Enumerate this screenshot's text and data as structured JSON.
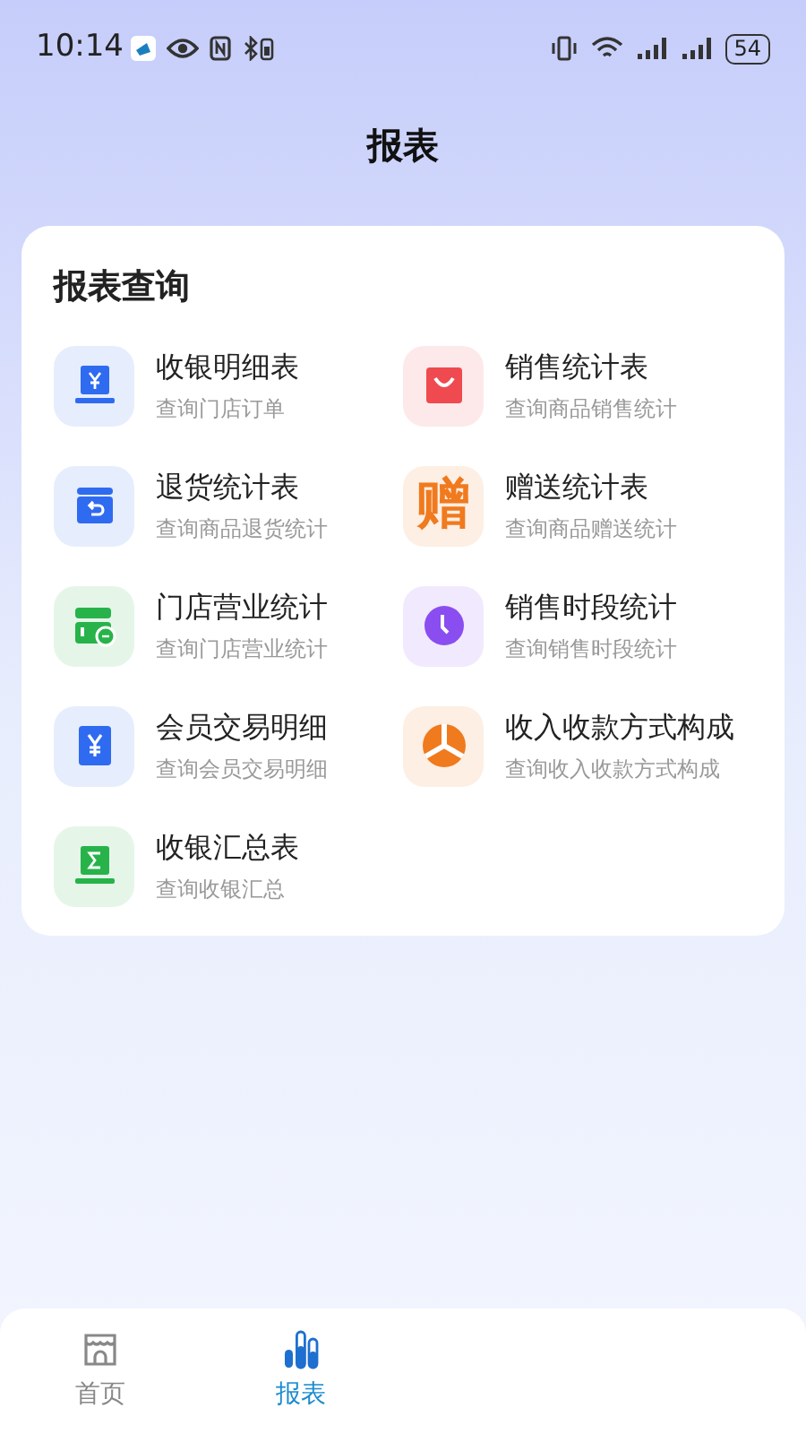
{
  "status_bar": {
    "time": "10:14",
    "battery": "54"
  },
  "header": {
    "title": "报表"
  },
  "card": {
    "title": "报表查询",
    "items": [
      {
        "title": "收银明细表",
        "subtitle": "查询门店订单",
        "kind": "receipt",
        "color": "#2f6bf0"
      },
      {
        "title": "销售统计表",
        "subtitle": "查询商品销售统计",
        "kind": "bag",
        "color": "#ef4a4f"
      },
      {
        "title": "退货统计表",
        "subtitle": "查询商品退货统计",
        "kind": "return",
        "color": "#2f6bf0"
      },
      {
        "title": "赠送统计表",
        "subtitle": "查询商品赠送统计",
        "kind": "glyph",
        "glyph": "赠",
        "color": "#f07a1e"
      },
      {
        "title": "门店营业统计",
        "subtitle": "查询门店营业统计",
        "kind": "store",
        "color": "#27b34a"
      },
      {
        "title": "销售时段统计",
        "subtitle": "查询销售时段统计",
        "kind": "clock",
        "color": "#8a4df0"
      },
      {
        "title": "会员交易明细",
        "subtitle": "查询会员交易明细",
        "kind": "wallet",
        "color": "#2f6bf0"
      },
      {
        "title": "收入收款方式构成",
        "subtitle": "查询收入收款方式构成",
        "kind": "pie",
        "color": "#f07a1e"
      },
      {
        "title": "收银汇总表",
        "subtitle": "查询收银汇总",
        "kind": "sum",
        "color": "#27b34a"
      }
    ]
  },
  "tabs": [
    {
      "label": "首页",
      "kind": "home",
      "selected": false
    },
    {
      "label": "报表",
      "kind": "chart",
      "selected": true
    }
  ]
}
